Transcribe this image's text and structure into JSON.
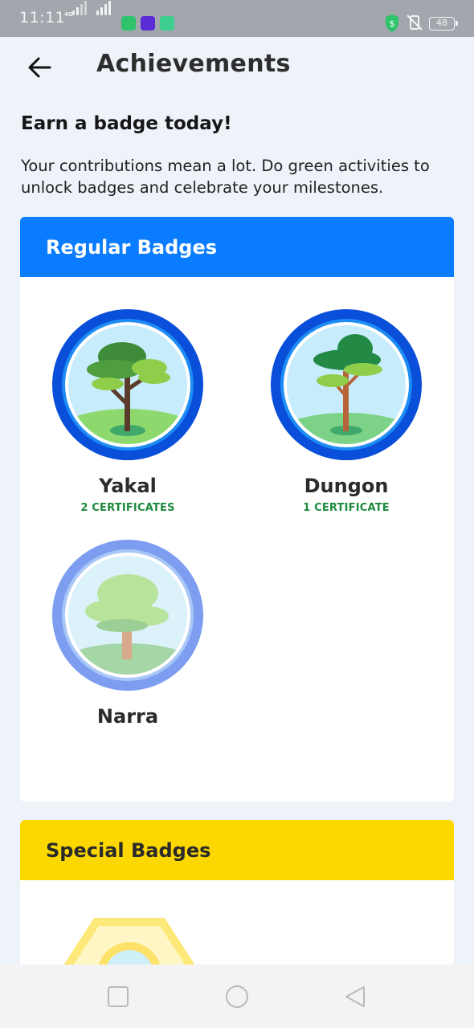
{
  "status_bar": {
    "time": "11:11",
    "network": "4G",
    "battery": "48",
    "icons": [
      "signal-icon",
      "chat-app-icon",
      "shopping-app-icon",
      "browser-app-icon",
      "shield-icon",
      "mute-icon",
      "battery-icon"
    ]
  },
  "header": {
    "title": "Achievements",
    "back_icon": "arrow-left-icon"
  },
  "intro": {
    "heading": "Earn a badge today!",
    "description": "Your contributions mean a lot. Do green activities to unlock badges and celebrate your milestones."
  },
  "regular_badges": {
    "title": "Regular Badges",
    "items": [
      {
        "name": "Yakal",
        "count": "2 CERTIFICATES",
        "state": "earned"
      },
      {
        "name": "Dungon",
        "count": "1 CERTIFICATE",
        "state": "earned"
      },
      {
        "name": "Narra",
        "count": "",
        "state": "locked"
      }
    ]
  },
  "special_badges": {
    "title": "Special Badges"
  },
  "colors": {
    "accent_blue": "#0a7cff",
    "accent_yellow": "#fcd700",
    "certificate_green": "#1c8a3c",
    "background": "#eef2f9"
  },
  "nav": [
    "recent-apps-icon",
    "home-icon",
    "back-icon"
  ]
}
